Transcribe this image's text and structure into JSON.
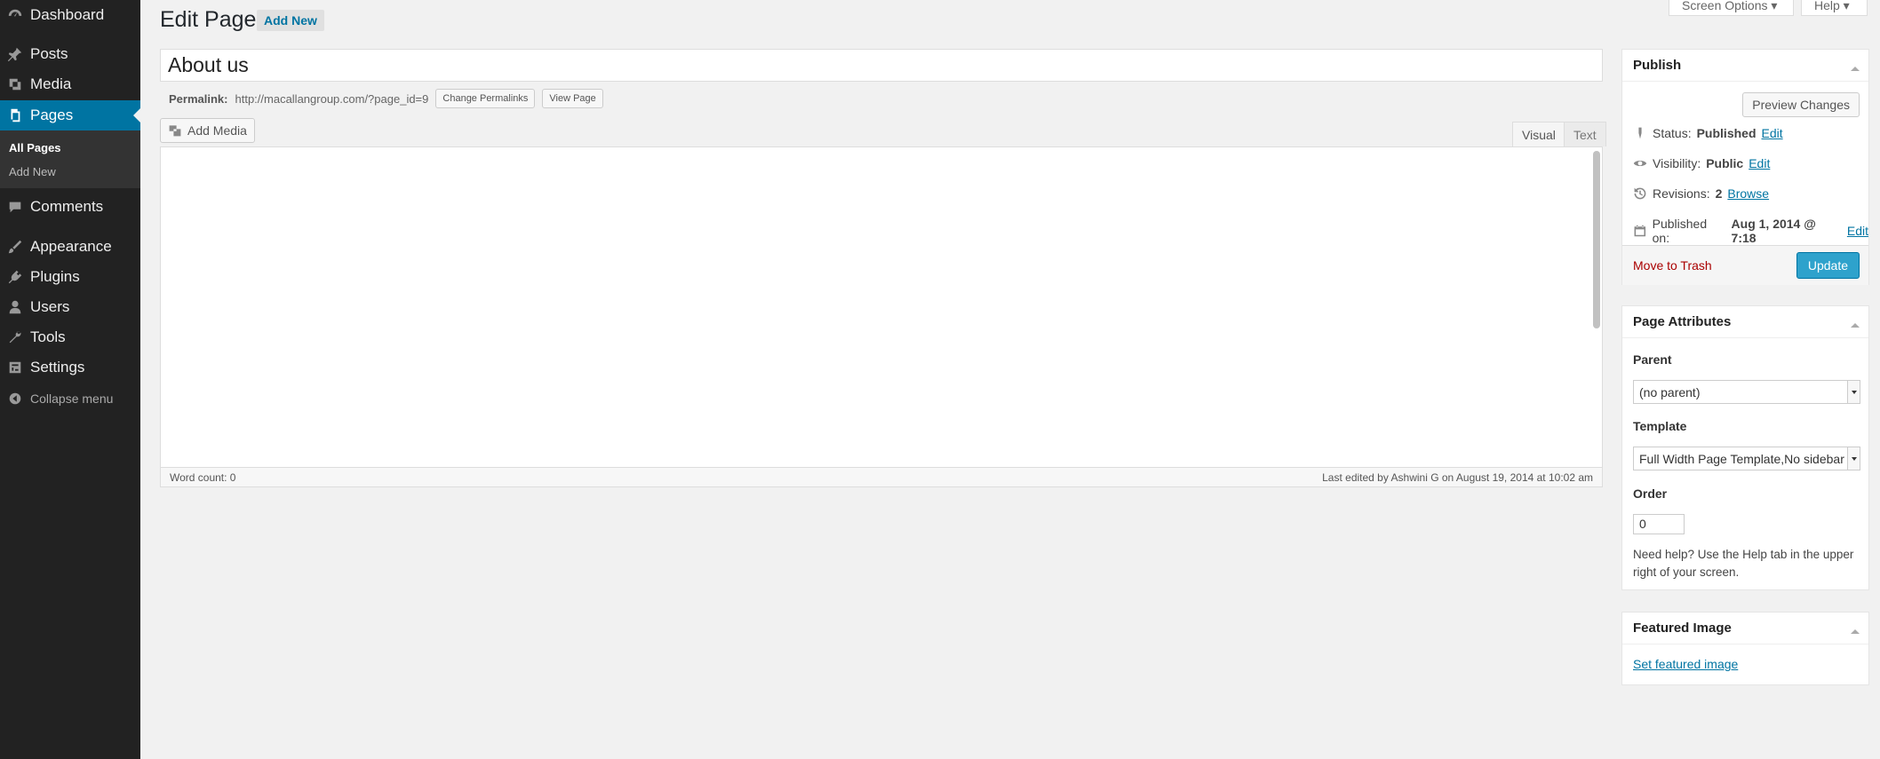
{
  "sidebar": {
    "items": [
      {
        "label": "Dashboard",
        "icon": "dashboard-icon"
      },
      {
        "label": "Posts",
        "icon": "pin-icon"
      },
      {
        "label": "Media",
        "icon": "media-icon"
      },
      {
        "label": "Pages",
        "icon": "pages-icon",
        "current": true
      },
      {
        "label": "Comments",
        "icon": "comment-icon"
      },
      {
        "label": "Appearance",
        "icon": "brush-icon"
      },
      {
        "label": "Plugins",
        "icon": "plug-icon"
      },
      {
        "label": "Users",
        "icon": "user-icon"
      },
      {
        "label": "Tools",
        "icon": "wrench-icon"
      },
      {
        "label": "Settings",
        "icon": "settings-icon"
      }
    ],
    "submenu": {
      "all_pages": "All Pages",
      "add_new": "Add New"
    },
    "collapse_label": "Collapse menu"
  },
  "header": {
    "title": "Edit Page",
    "add_new": "Add New",
    "screen_options": "Screen Options ▾",
    "help": "Help ▾"
  },
  "editor": {
    "title_value": "About us",
    "permalink_label": "Permalink:",
    "permalink_url": "http://macallangroup.com/?page_id=9",
    "change_permalinks": "Change Permalinks",
    "view_page": "View Page",
    "add_media": "Add Media",
    "tab_visual": "Visual",
    "tab_text": "Text",
    "word_count": "Word count: 0",
    "last_edited": "Last edited by Ashwini G on August 19, 2014 at 10:02 am"
  },
  "publish": {
    "title": "Publish",
    "preview": "Preview Changes",
    "status_label": "Status:",
    "status_value": "Published",
    "visibility_label": "Visibility:",
    "visibility_value": "Public",
    "revisions_label": "Revisions:",
    "revisions_value": "2",
    "browse": "Browse",
    "published_label": "Published on:",
    "published_value": "Aug 1, 2014 @ 7:18",
    "edit": "Edit",
    "trash": "Move to Trash",
    "update": "Update"
  },
  "attributes": {
    "title": "Page Attributes",
    "parent_label": "Parent",
    "parent_value": "(no parent)",
    "template_label": "Template",
    "template_value": "Full Width Page Template,No sidebar",
    "order_label": "Order",
    "order_value": "0",
    "help_text": "Need help? Use the Help tab in the upper right of your screen."
  },
  "featured": {
    "title": "Featured Image",
    "set_link": "Set featured image"
  },
  "colors": {
    "sidebar_bg": "#222222",
    "accent": "#0074a2",
    "update_button": "#2ea2cc",
    "trash": "#a00000"
  }
}
